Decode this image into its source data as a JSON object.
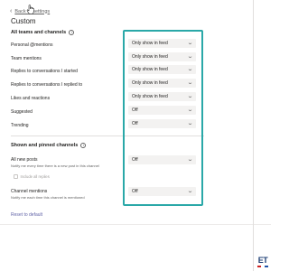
{
  "header": {
    "back_label": "Back to settings"
  },
  "page_title": "Custom",
  "section_all": {
    "title": "All teams and channels",
    "rows": [
      {
        "label": "Personal @mentions",
        "value": "Only show in feed"
      },
      {
        "label": "Team mentions",
        "value": "Only show in feed"
      },
      {
        "label": "Replies to conversations I started",
        "value": "Only show in feed"
      },
      {
        "label": "Replies to conversations I replied to",
        "value": "Only show in feed"
      },
      {
        "label": "Likes and reactions",
        "value": "Only show in feed"
      },
      {
        "label": "Suggested",
        "value": "Off"
      },
      {
        "label": "Trending",
        "value": "Off"
      }
    ]
  },
  "section_pinned": {
    "title": "Shown and pinned channels",
    "all_new_posts": {
      "label": "All new posts",
      "description": "Notify me every time there is a new post in this channel",
      "value": "Off",
      "checkbox_label": "Include all replies"
    },
    "channel_mentions": {
      "label": "Channel mentions",
      "description": "Notify me each time this channel is mentioned",
      "value": "Off"
    }
  },
  "reset_label": "Reset to default",
  "brand": {
    "text": "ET"
  },
  "colors": {
    "highlight": "#2aa8a8",
    "link": "#6264a7",
    "dropdown_bg": "#f3f2f1"
  }
}
